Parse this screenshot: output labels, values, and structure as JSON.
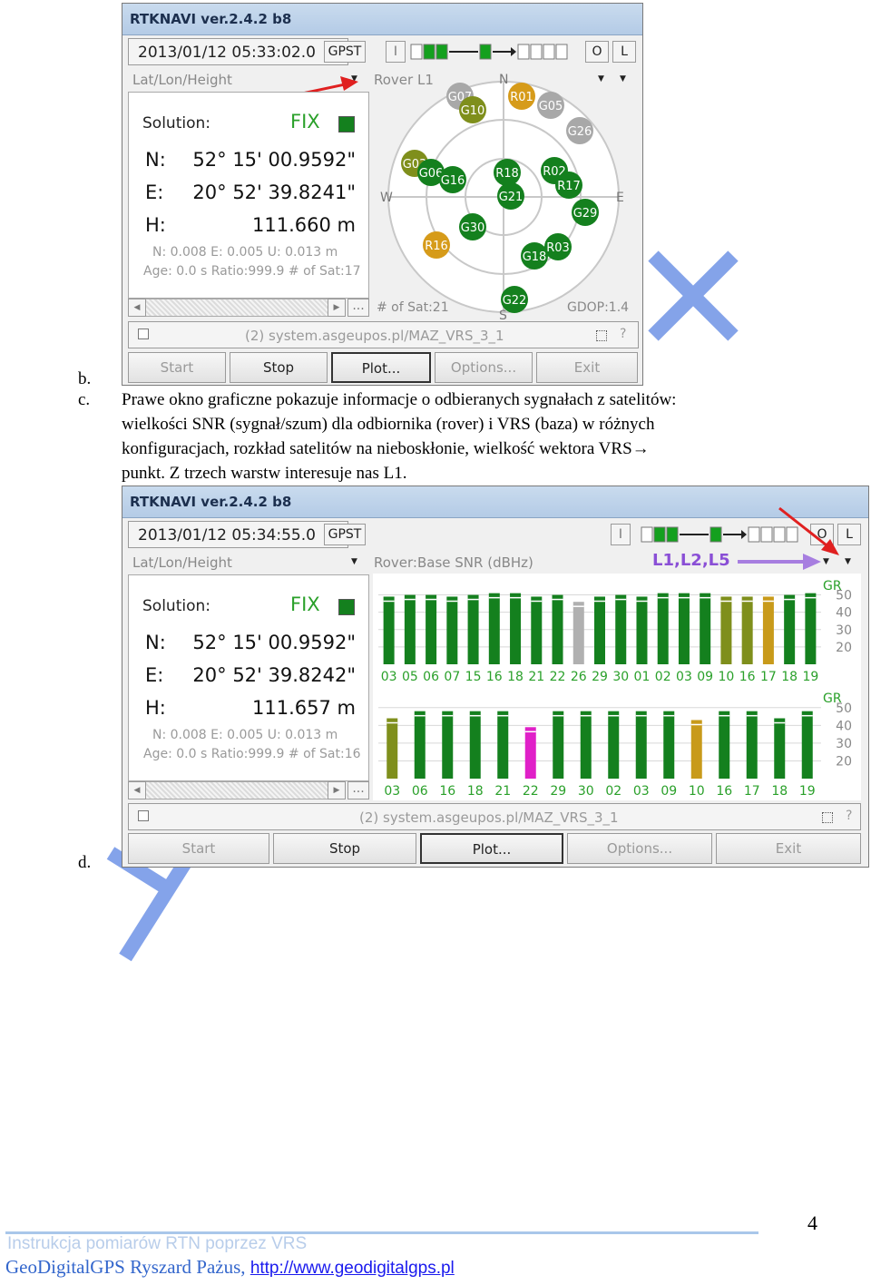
{
  "doc": {
    "label_b": "b.",
    "label_c": "c.",
    "label_d": "d.",
    "paragraph_lines": [
      "Prawe okno graficzne pokazuje informacje o odbieranych sygnałach z satelitów:",
      "wielkości SNR (sygnał/szum) dla odbiornika (rover) i VRS (baza) w różnych",
      "konfiguracjach, rozkład satelitów na nieboskłonie, wielkość wektora VRS→",
      "punkt. Z trzech warstw interesuje nas L1."
    ],
    "watermark": "Ar...a X",
    "page_number": "4",
    "footer_line1": "Instrukcja pomiarów RTN poprzez VRS",
    "footer_line2": "GeoDigitalGPS Ryszard Pażus,",
    "footer_link": "http://www.geodigitalgps.pl"
  },
  "window1": {
    "title": "RTKNAVI ver.2.4.2 b8",
    "datetime": "2013/01/12 05:33:02.0",
    "time_sys": "GPST",
    "btn_i": "I",
    "btn_o": "O",
    "btn_l": "L",
    "left_dropdown": "Lat/Lon/Height",
    "right_dropdown": "Rover L1",
    "solution_label": "Solution:",
    "solution_status": "FIX",
    "n_label": "N:",
    "n_value": "52° 15' 00.9592\"",
    "e_label": "E:",
    "e_value": "20° 52' 39.8241\"",
    "h_label": "H:",
    "h_value": "111.660 m",
    "stats1": "N: 0.008 E: 0.005 U: 0.013 m",
    "stats2": "Age: 0.0 s Ratio:999.9 # of Sat:17",
    "sky_n": "N",
    "sky_e": "E",
    "sky_w": "W",
    "sky_s": "S",
    "num_sats": "# of Sat:21",
    "gdop": "GDOP:1.4",
    "stream": "(2) system.asgeupos.pl/MAZ_VRS_3_1",
    "help": "?",
    "buttons": [
      "Start",
      "Stop",
      "Plot...",
      "Options...",
      "Exit"
    ],
    "satellites": [
      {
        "id": "G07",
        "color": "#a8a8a8"
      },
      {
        "id": "G10",
        "color": "#7f8f1c"
      },
      {
        "id": "R01",
        "color": "#d69b1a"
      },
      {
        "id": "G05",
        "color": "#a8a8a8"
      },
      {
        "id": "G26",
        "color": "#a8a8a8"
      },
      {
        "id": "G03",
        "color": "#7f8f1c"
      },
      {
        "id": "G06",
        "color": "#14801e"
      },
      {
        "id": "G16",
        "color": "#14801e"
      },
      {
        "id": "R18",
        "color": "#14801e"
      },
      {
        "id": "R02",
        "color": "#14801e"
      },
      {
        "id": "R17",
        "color": "#14801e"
      },
      {
        "id": "G21",
        "color": "#14801e"
      },
      {
        "id": "G29",
        "color": "#14801e"
      },
      {
        "id": "G30",
        "color": "#14801e"
      },
      {
        "id": "R16",
        "color": "#d69b1a"
      },
      {
        "id": "R03",
        "color": "#14801e"
      },
      {
        "id": "G18",
        "color": "#14801e"
      },
      {
        "id": "G22",
        "color": "#14801e"
      }
    ]
  },
  "window2": {
    "title": "RTKNAVI ver.2.4.2 b8",
    "datetime": "2013/01/12 05:34:55.0",
    "time_sys": "GPST",
    "btn_i": "I",
    "btn_o": "O",
    "btn_l": "L",
    "left_dropdown": "Lat/Lon/Height",
    "right_dropdown": "Rover:Base SNR (dBHz)",
    "annotation": "L1,L2,L5",
    "solution_label": "Solution:",
    "solution_status": "FIX",
    "n_label": "N:",
    "n_value": "52° 15' 00.9592\"",
    "e_label": "E:",
    "e_value": "20° 52' 39.8242\"",
    "h_label": "H:",
    "h_value": "111.657 m",
    "stats1": "N: 0.008 E: 0.005 U: 0.013 m",
    "stats2": "Age: 0.0 s Ratio:999.9 # of Sat:16",
    "stream": "(2) system.asgeupos.pl/MAZ_VRS_3_1",
    "help": "?",
    "buttons": [
      "Start",
      "Stop",
      "Plot...",
      "Options...",
      "Exit"
    ]
  },
  "chart_data": [
    {
      "type": "bar",
      "title": "Rover SNR",
      "legend": "GR",
      "ylim": [
        10,
        55
      ],
      "yticks": [
        "50",
        "40",
        "30",
        "20"
      ],
      "categories": [
        "03",
        "05",
        "06",
        "07",
        "15",
        "16",
        "18",
        "21",
        "22",
        "26",
        "29",
        "30",
        "01",
        "02",
        "03",
        "09",
        "10",
        "16",
        "17",
        "18",
        "19"
      ],
      "values": [
        49,
        50,
        50,
        49,
        50,
        51,
        51,
        49,
        50,
        46,
        49,
        50,
        49,
        51,
        51,
        51,
        49,
        49,
        49,
        50,
        51
      ],
      "colors": [
        "#14801e",
        "#14801e",
        "#14801e",
        "#14801e",
        "#14801e",
        "#14801e",
        "#14801e",
        "#14801e",
        "#14801e",
        "#b0b0b0",
        "#14801e",
        "#14801e",
        "#14801e",
        "#14801e",
        "#14801e",
        "#14801e",
        "#7f8f1c",
        "#7f8f1c",
        "#c89a1a",
        "#14801e",
        "#14801e"
      ]
    },
    {
      "type": "bar",
      "title": "Base SNR",
      "legend": "GR",
      "ylim": [
        10,
        55
      ],
      "yticks": [
        "50",
        "40",
        "30",
        "20"
      ],
      "categories": [
        "03",
        "06",
        "16",
        "18",
        "21",
        "22",
        "29",
        "30",
        "02",
        "03",
        "09",
        "10",
        "16",
        "17",
        "18",
        "19"
      ],
      "values": [
        44,
        48,
        48,
        48,
        48,
        39,
        48,
        48,
        48,
        48,
        48,
        43,
        48,
        48,
        44,
        48
      ],
      "colors": [
        "#7f8f1c",
        "#14801e",
        "#14801e",
        "#14801e",
        "#14801e",
        "#e020c8",
        "#14801e",
        "#14801e",
        "#14801e",
        "#14801e",
        "#14801e",
        "#c89a1a",
        "#14801e",
        "#14801e",
        "#14801e",
        "#14801e"
      ]
    }
  ]
}
